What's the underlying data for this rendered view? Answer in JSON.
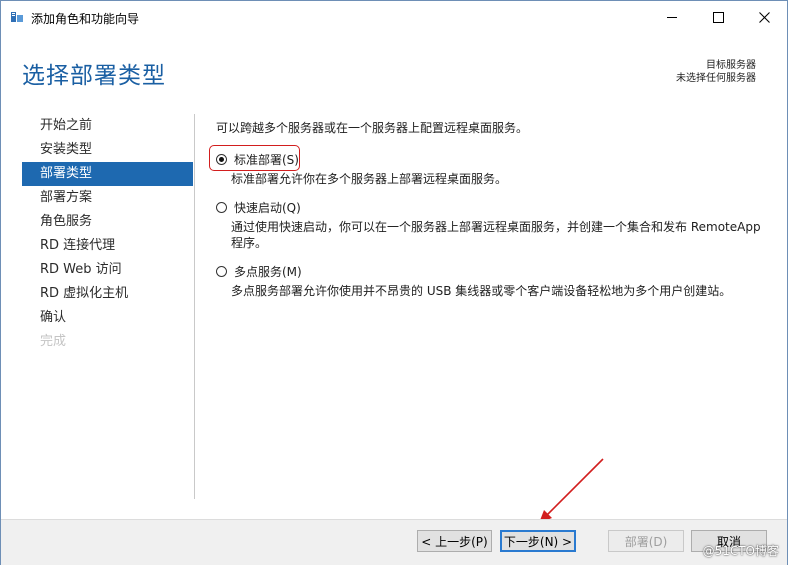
{
  "window": {
    "title": "添加角色和功能向导"
  },
  "header": {
    "title": "选择部署类型",
    "destination_label": "目标服务器",
    "destination_value": "未选择任何服务器"
  },
  "sidebar": {
    "items": [
      {
        "label": "开始之前",
        "state": "normal"
      },
      {
        "label": "安装类型",
        "state": "normal"
      },
      {
        "label": "部署类型",
        "state": "active"
      },
      {
        "label": "部署方案",
        "state": "normal"
      },
      {
        "label": "角色服务",
        "state": "normal"
      },
      {
        "label": "RD 连接代理",
        "state": "normal"
      },
      {
        "label": "RD Web 访问",
        "state": "normal"
      },
      {
        "label": "RD 虚拟化主机",
        "state": "normal"
      },
      {
        "label": "确认",
        "state": "normal"
      },
      {
        "label": "完成",
        "state": "disabled"
      }
    ]
  },
  "content": {
    "intro": "可以跨越多个服务器或在一个服务器上配置远程桌面服务。",
    "options": [
      {
        "label": "标准部署(S)",
        "selected": true,
        "description": "标准部署允许你在多个服务器上部署远程桌面服务。"
      },
      {
        "label": "快速启动(Q)",
        "selected": false,
        "description": "通过使用快速启动，你可以在一个服务器上部署远程桌面服务，并创建一个集合和发布 RemoteApp 程序。"
      },
      {
        "label": "多点服务(M)",
        "selected": false,
        "description": "多点服务部署允许你使用并不昂贵的 USB 集线器或零个客户端设备轻松地为多个用户创建站。"
      }
    ]
  },
  "footer": {
    "prev_label": "< 上一步(P)",
    "next_label": "下一步(N) >",
    "deploy_label": "部署(D)",
    "cancel_label": "取消"
  },
  "watermark": "@51CTO博客",
  "colors": {
    "accent": "#1e69b0",
    "header_title": "#1a5fa3",
    "annotation": "#d21e1e"
  }
}
